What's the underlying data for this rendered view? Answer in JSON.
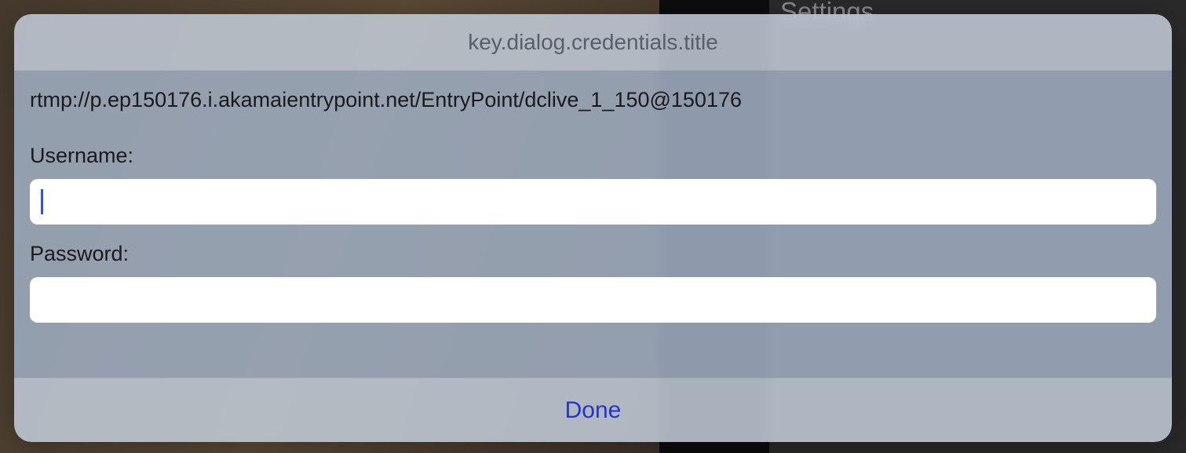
{
  "background": {
    "settings_label": "Settings"
  },
  "dialog": {
    "title": "key.dialog.credentials.title",
    "url": "rtmp://p.ep150176.i.akamaientrypoint.net/EntryPoint/dclive_1_150@150176",
    "username_label": "Username:",
    "username_value": "",
    "password_label": "Password:",
    "password_value": "",
    "done_label": "Done"
  }
}
